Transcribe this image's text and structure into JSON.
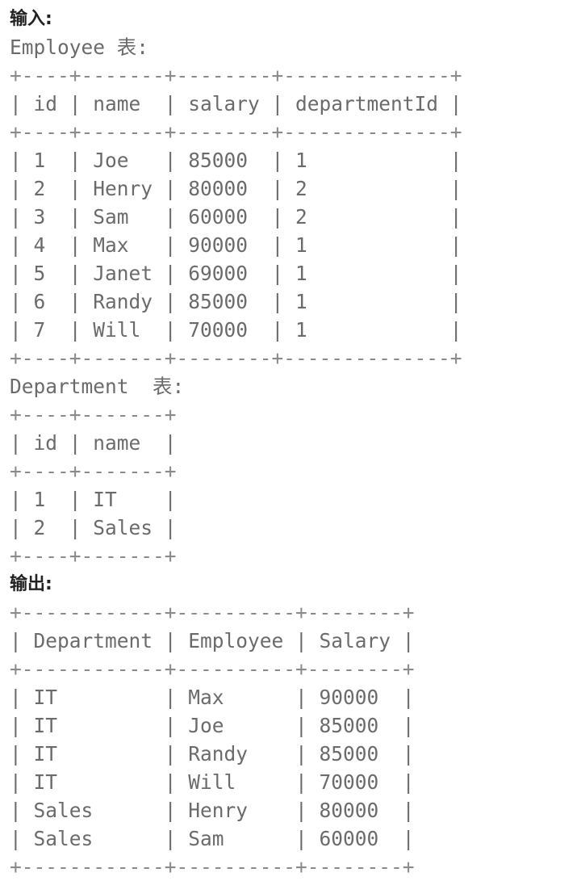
{
  "input_heading": "输入:",
  "employee_caption": "Employee 表:",
  "employee_table": [
    "+----+-------+--------+--------------+",
    "| id | name  | salary | departmentId |",
    "+----+-------+--------+--------------+",
    "| 1  | Joe   | 85000  | 1            |",
    "| 2  | Henry | 80000  | 2            |",
    "| 3  | Sam   | 60000  | 2            |",
    "| 4  | Max   | 90000  | 1            |",
    "| 5  | Janet | 69000  | 1            |",
    "| 6  | Randy | 85000  | 1            |",
    "| 7  | Will  | 70000  | 1            |",
    "+----+-------+--------+--------------+"
  ],
  "department_caption": "Department  表:",
  "department_table": [
    "+----+-------+",
    "| id | name  |",
    "+----+-------+",
    "| 1  | IT    |",
    "| 2  | Sales |",
    "+----+-------+"
  ],
  "output_heading": "输出:",
  "output_table": [
    "+------------+----------+--------+",
    "| Department | Employee | Salary |",
    "+------------+----------+--------+",
    "| IT         | Max      | 90000  |",
    "| IT         | Joe      | 85000  |",
    "| IT         | Randy    | 85000  |",
    "| IT         | Will     | 70000  |",
    "| Sales      | Henry    | 80000  |",
    "| Sales      | Sam      | 60000  |",
    "+------------+----------+--------+"
  ]
}
